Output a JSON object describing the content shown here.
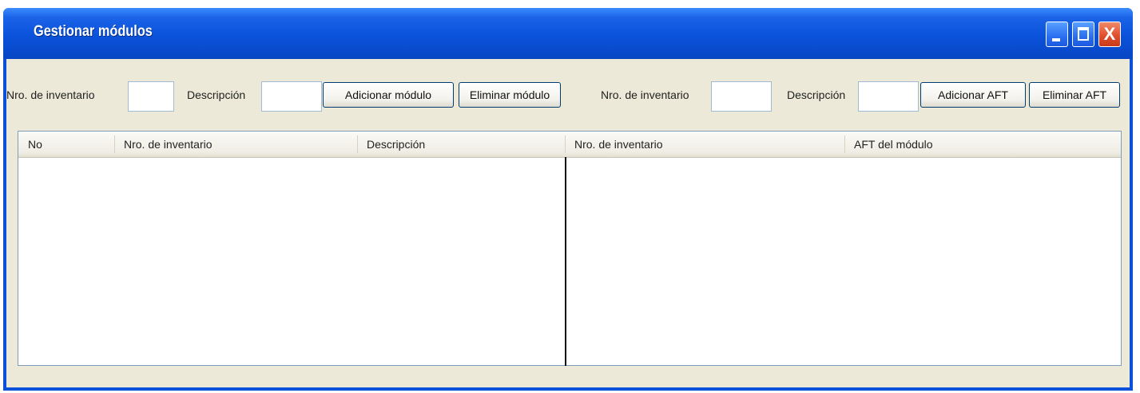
{
  "window": {
    "title": "Gestionar módulos",
    "controls": {
      "close_glyph": "X"
    }
  },
  "toolbar_modules": {
    "inventory_label": "Nro. de inventario",
    "inventory_value": "",
    "description_label": "Descripción",
    "description_value": "",
    "add_label": "Adicionar módulo",
    "delete_label": "Eliminar módulo"
  },
  "toolbar_aft": {
    "inventory_label": "Nro. de inventario",
    "inventory_value": "",
    "description_label": "Descripción",
    "description_value": "",
    "add_label": "Adicionar AFT",
    "delete_label": "Eliminar AFT"
  },
  "table": {
    "columns": [
      "No",
      "Nro. de inventario",
      "Descripción",
      "Nro. de inventario",
      "AFT del módulo"
    ],
    "rows": []
  },
  "colors": {
    "title_bar": "#0a52da",
    "client_background": "#ece9d8",
    "close_button": "#e0502e"
  },
  "icons": [
    "minimize-icon",
    "maximize-icon",
    "close-icon"
  ]
}
